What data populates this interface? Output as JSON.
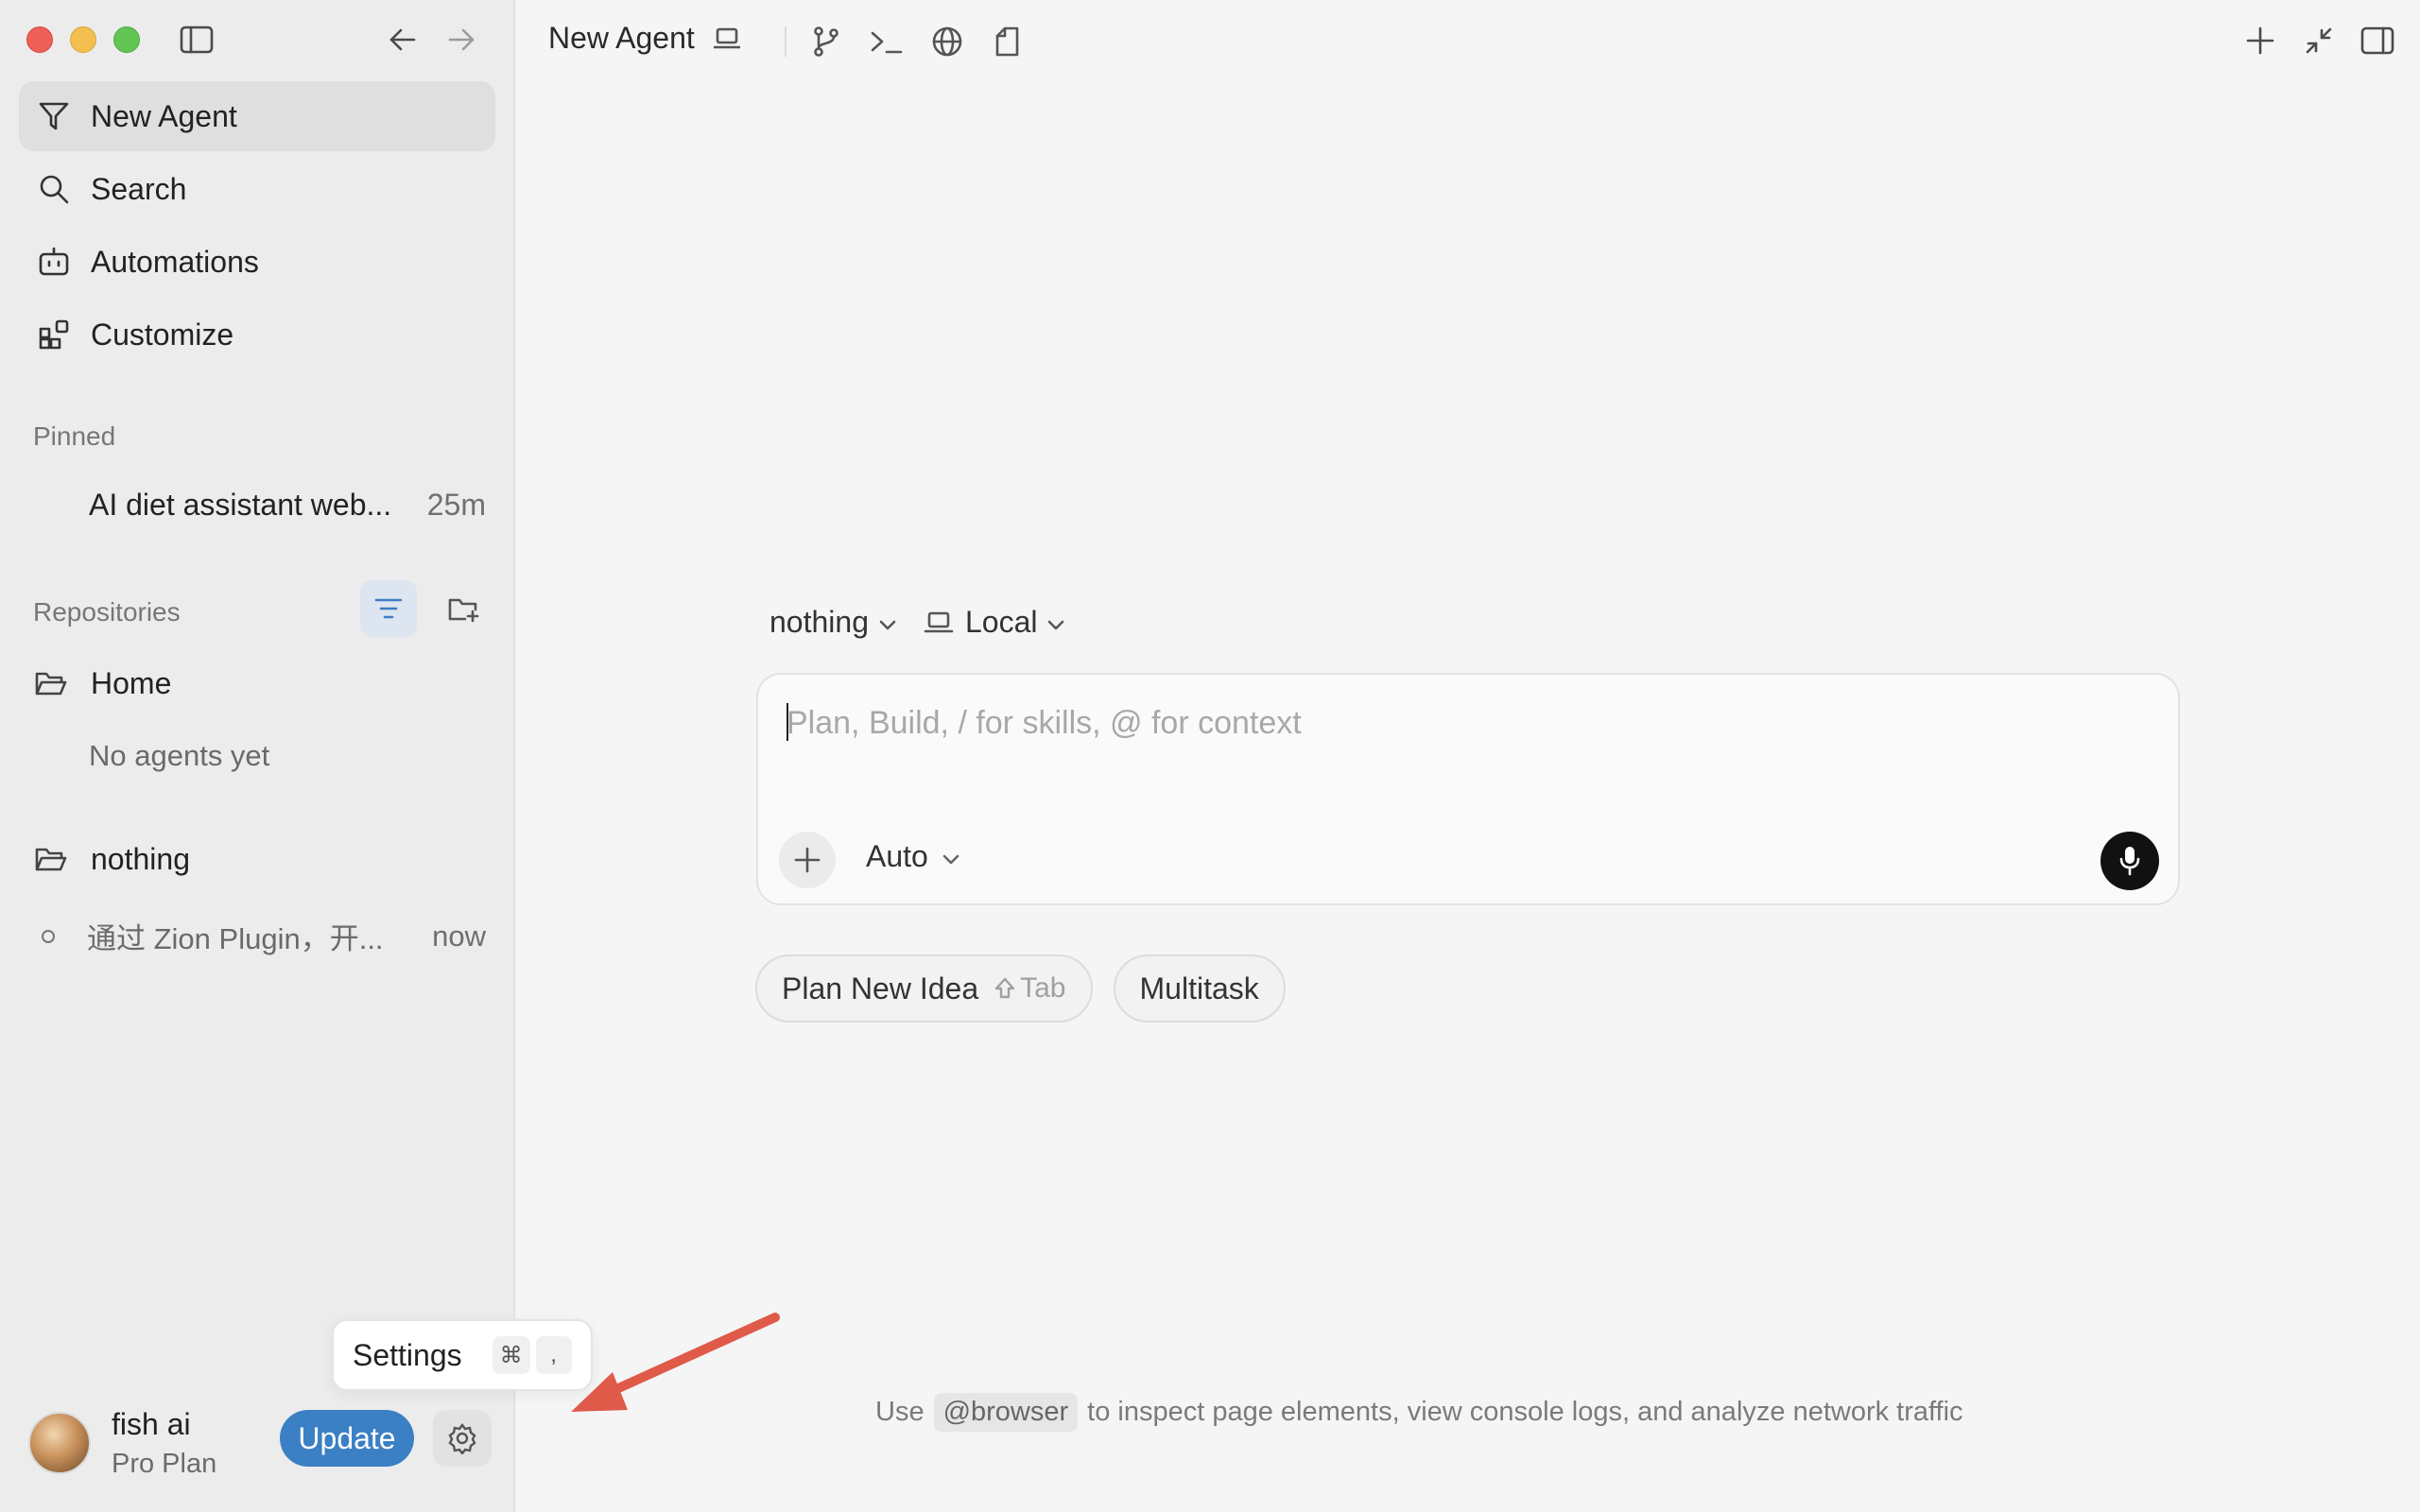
{
  "sidebar": {
    "nav": [
      {
        "label": "New Agent",
        "icon": "send-icon"
      },
      {
        "label": "Search",
        "icon": "search-icon"
      },
      {
        "label": "Automations",
        "icon": "robot-icon"
      },
      {
        "label": "Customize",
        "icon": "grid-plus-icon"
      }
    ],
    "pinned_label": "Pinned",
    "pinned": [
      {
        "title": "AI diet assistant web...",
        "time": "25m"
      }
    ],
    "repositories_label": "Repositories",
    "repos": [
      {
        "name": "Home",
        "empty_text": "No agents yet"
      },
      {
        "name": "nothing",
        "agents": [
          {
            "title": "通过 Zion Plugin，开...",
            "time": "now"
          }
        ]
      }
    ],
    "user": {
      "name": "fish ai",
      "plan": "Pro Plan"
    },
    "update_label": "Update",
    "tooltip": {
      "label": "Settings",
      "keys": [
        "⌘",
        ","
      ]
    }
  },
  "topbar": {
    "title": "New Agent"
  },
  "composer": {
    "workspace": "nothing",
    "location": "Local",
    "placeholder": "Plan, Build, / for skills, @ for context",
    "value": "",
    "mode": "Auto"
  },
  "chips": [
    {
      "label": "Plan New Idea",
      "hint": "Tab"
    },
    {
      "label": "Multitask"
    }
  ],
  "footer": {
    "prefix": "Use",
    "code": "@browser",
    "suffix": "to inspect page elements, view console logs, and analyze network traffic"
  },
  "colors": {
    "accent": "#3b7fc4",
    "annotation_arrow": "#e05a4a"
  }
}
